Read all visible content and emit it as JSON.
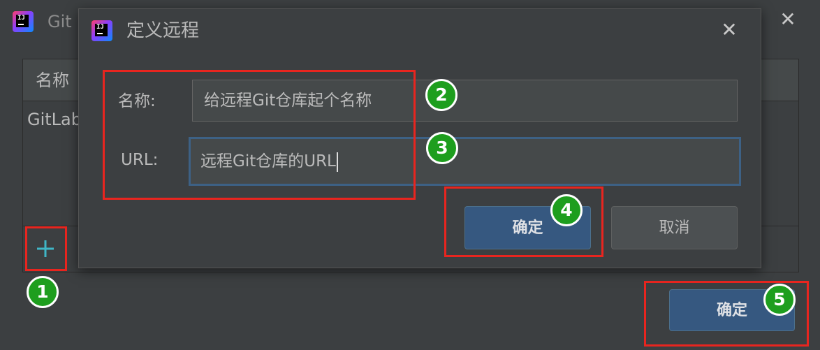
{
  "background_window": {
    "title": "Git",
    "table_header_name": "名称",
    "table_row_name": "GitLab",
    "add_icon": "plus-icon",
    "ok_label": "确定"
  },
  "dialog": {
    "title": "定义远程",
    "name_label": "名称:",
    "name_value": "给远程Git仓库起个名称",
    "url_label": "URL:",
    "url_value": "远程Git仓库的URL",
    "ok_label": "确定",
    "cancel_label": "取消"
  },
  "badges": [
    "1",
    "2",
    "3",
    "4",
    "5"
  ],
  "colors": {
    "window_bg": "#3c3f41",
    "primary_button": "#365880",
    "highlight_box": "#e8251f",
    "badge": "#1e9e1e"
  }
}
